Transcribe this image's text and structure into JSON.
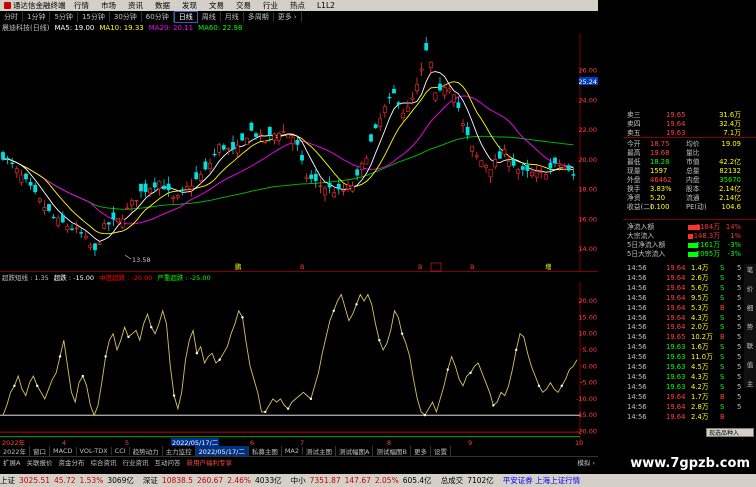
{
  "menu": {
    "app_title": "通达信金融终端",
    "items": [
      "行情",
      "市场",
      "资讯",
      "数据",
      "发现",
      "文易",
      "交易",
      "行业",
      "热点",
      "L1L2"
    ],
    "right_link": "交易 ",
    "window_buttons": [
      "_",
      "□",
      "×"
    ]
  },
  "periods": {
    "items": [
      "分时",
      "1分钟",
      "5分钟",
      "15分钟",
      "30分钟",
      "60分钟",
      "日线",
      "周线",
      "月线",
      "多周期",
      "更多 ›"
    ],
    "selected": "日线"
  },
  "ma_line": {
    "stock": "晨迪科技(日线)",
    "items": [
      {
        "label": "MA5: 19.00",
        "color": "#ffffff"
      },
      {
        "label": "MA10: 19.33",
        "color": "#ffff00"
      },
      {
        "label": "MA20: 20.11",
        "color": "#ff00ff"
      },
      {
        "label": "MA60: 22.98",
        "color": "#00ff00"
      }
    ]
  },
  "price_axis": {
    "labels": [
      "26.00",
      "24.00",
      "22.00",
      "20.00",
      "18.00",
      "16.00",
      "14.00"
    ],
    "top_marker": "25.24",
    "low_label": "13.58"
  },
  "indicator_bar": {
    "items": [
      {
        "label": "超跌短线 : 1.35",
        "color": "#c0c0c0"
      },
      {
        "label": "超跌 : -15.00",
        "color": "#ffffff"
      },
      {
        "label": "中度超跌 : -20.00",
        "color": "#ff0000"
      },
      {
        "label": "严重超跌 : -25.00",
        "color": "#00ff00"
      }
    ]
  },
  "osc_axis": {
    "labels": [
      "20.00",
      "15.00",
      "10.00",
      "5.00",
      "0.00",
      "-5.00",
      "-10.00",
      "-15.00",
      "-20.00"
    ]
  },
  "date_axis": {
    "labels": [
      "2022年",
      "4",
      "5",
      "2022/05/17/二",
      "6",
      "7",
      "8",
      "9",
      "10"
    ]
  },
  "event_markers": {
    "items": [
      "鹏",
      "B",
      "B",
      "B",
      "B",
      "增"
    ]
  },
  "chart_data": {
    "type": "candlestick",
    "ma": [
      "MA5",
      "MA10",
      "MA20",
      "MA60"
    ],
    "price_range": [
      13.0,
      28.0
    ],
    "indicator": {
      "name": "超跌短线",
      "levels": {
        "超跌": -15,
        "中度超跌": -20,
        "严重超跌": -25
      },
      "range": [
        -22,
        24
      ],
      "values": [
        -15,
        -12,
        -8,
        -6,
        -3,
        -7,
        -9,
        -5,
        -3,
        -6,
        -8,
        -10,
        -7,
        -4,
        -2,
        3,
        8,
        0,
        -8,
        -11,
        -5,
        -3,
        -6,
        -12,
        -15,
        -12,
        -5,
        3,
        8,
        10,
        5,
        8,
        12,
        9,
        10,
        11,
        8,
        13,
        16,
        12,
        10,
        13,
        17,
        13,
        0,
        -9,
        -13,
        -8,
        2,
        8,
        11,
        4,
        6,
        1,
        3,
        4,
        1,
        2,
        4,
        6,
        10,
        13,
        17,
        15,
        7,
        0,
        -4,
        -8,
        -14,
        -14,
        -12,
        -10,
        -11,
        -10,
        -12,
        -13,
        -11,
        -10,
        -9,
        -8,
        -9,
        -10,
        -6,
        -2,
        4,
        9,
        14,
        17,
        20,
        22,
        18,
        14,
        16,
        19,
        22,
        20,
        22,
        19,
        13,
        8,
        5,
        7,
        11,
        17,
        15,
        10,
        7,
        3,
        -4,
        -10,
        -14,
        -15,
        -13,
        -11,
        -14,
        -10,
        -6,
        -1,
        3,
        0,
        -4,
        -6,
        -3,
        -2,
        0,
        1,
        -2,
        -5,
        -8,
        -12,
        -11,
        -8,
        -9,
        -6,
        -1,
        5,
        10,
        9,
        4,
        0,
        -3,
        -6,
        -8,
        -7,
        -5,
        -7,
        -8,
        -6,
        -4,
        -1,
        0,
        2
      ]
    }
  },
  "quote": {
    "asks": [
      {
        "label": "卖三",
        "price": "19.65",
        "vol": "31.6万"
      },
      {
        "label": "卖四",
        "price": "19.64",
        "vol": "32.4万"
      },
      {
        "label": "卖五",
        "price": "19.63",
        "vol": "7.1万"
      }
    ],
    "fields": [
      {
        "l1": "今开",
        "v1": "18.75",
        "l2": "均价",
        "v2": "19.09"
      },
      {
        "l1": "最高",
        "v1": "19.68",
        "l2": "量比",
        "v2": ""
      },
      {
        "l1": "最低",
        "v1": "18.28",
        "l2": "市值",
        "v2": "42.2亿"
      },
      {
        "l1": "现量",
        "v1": "1597",
        "l2": "总量",
        "v2": "82132"
      },
      {
        "l1": "外盘",
        "v1": "46462",
        "l2": "内盘",
        "v2": "35670"
      },
      {
        "l1": "换手",
        "v1": "3.83%",
        "l2": "股本",
        "v2": "2.14亿"
      },
      {
        "l1": "净资",
        "v1": "5.20",
        "l2": "流通",
        "v2": "2.14亿"
      },
      {
        "l1": "收益(二)",
        "v1": "0.100",
        "l2": "PE(动)",
        "v2": "104.6"
      }
    ],
    "flows": [
      {
        "label": "净流入额",
        "value": "2184万",
        "pct": "14%",
        "color": "#ff3030"
      },
      {
        "label": "大宗流入",
        "value": "148.3万",
        "pct": "1%",
        "color": "#ff3030"
      },
      {
        "label": "5日净流入额",
        "value": "-2161万",
        "pct": "-3%",
        "color": "#00ff00"
      },
      {
        "label": "5日大宗流入",
        "value": "2095万",
        "pct": "-3%",
        "color": "#00ff00"
      }
    ],
    "ticks": [
      {
        "t": "14:56",
        "p": "19.64",
        "v": "1.4万",
        "d": "S"
      },
      {
        "t": "14:56",
        "p": "19.64",
        "v": "2.6万",
        "d": "S"
      },
      {
        "t": "14:56",
        "p": "19.64",
        "v": "5.6万",
        "d": "S"
      },
      {
        "t": "14:56",
        "p": "19.64",
        "v": "9.5万",
        "d": "S"
      },
      {
        "t": "14:56",
        "p": "19.64",
        "v": "5.3万",
        "d": "B"
      },
      {
        "t": "14:56",
        "p": "19.64",
        "v": "4.3万",
        "d": "S"
      },
      {
        "t": "14:56",
        "p": "19.64",
        "v": "2.0万",
        "d": "S"
      },
      {
        "t": "14:56",
        "p": "19.65",
        "v": "10.2万",
        "d": "B"
      },
      {
        "t": "14:56",
        "p": "19.63",
        "v": "1.6万",
        "d": "S"
      },
      {
        "t": "14:56",
        "p": "19.63",
        "v": "11.0万",
        "d": "S"
      },
      {
        "t": "14:56",
        "p": "19.63",
        "v": "4.5万",
        "d": "S"
      },
      {
        "t": "14:56",
        "p": "19.63",
        "v": "4.3万",
        "d": "S"
      },
      {
        "t": "14:56",
        "p": "19.63",
        "v": "4.2万",
        "d": "S"
      },
      {
        "t": "14:56",
        "p": "19.64",
        "v": "1.7万",
        "d": "B"
      },
      {
        "t": "14:56",
        "p": "19.64",
        "v": "2.8万",
        "d": "S"
      },
      {
        "t": "14:56",
        "p": "19.64",
        "v": "2.4万",
        "d": "B"
      }
    ],
    "tick_marks": [
      "5",
      "5",
      "5",
      "5",
      "5",
      "5",
      "5",
      "5",
      "5",
      "5",
      "5",
      "5",
      "5",
      "5",
      "5"
    ],
    "popup": "现选品种入",
    "bottom_tabs": [
      "笔",
      "价",
      "细",
      "势",
      "联",
      "值",
      "主"
    ]
  },
  "bottom_tabs": {
    "items": [
      "2022年",
      "窗口",
      "MACD",
      "VOL-TDX",
      "CCI",
      "趋势动力",
      "主力监控",
      "私募主图",
      "MA2",
      "测试主图",
      "测试幅图A",
      "测试幅图B",
      "更多",
      "设置"
    ],
    "selected": "2022/05/17/二"
  },
  "bottom_tabs2": {
    "items": [
      "扩展A",
      "关联报价",
      "资金分布",
      "综合资讯",
      "行业资讯",
      "互动问答",
      "新用户福利专享"
    ],
    "right": "模拟 ›"
  },
  "status": {
    "items": [
      {
        "name": "上证",
        "value": "3025.51",
        "chg": "45.72",
        "pct": "1.53%",
        "amt": "3069亿",
        "dir": "up"
      },
      {
        "name": "深证",
        "value": "10838.5",
        "chg": "260.67",
        "pct": "2.46%",
        "amt": "4033亿",
        "dir": "up"
      },
      {
        "name": "中小",
        "value": "7351.87",
        "chg": "147.67",
        "pct": "2.05%",
        "amt": "605.4亿",
        "dir": "up"
      },
      {
        "name": "总成交",
        "value": "7102亿",
        "chg": "",
        "pct": "",
        "amt": "",
        "dir": "none"
      }
    ],
    "ticker": "平安证券 上海上证行情",
    "watermark": "www.7gpzb.com"
  }
}
